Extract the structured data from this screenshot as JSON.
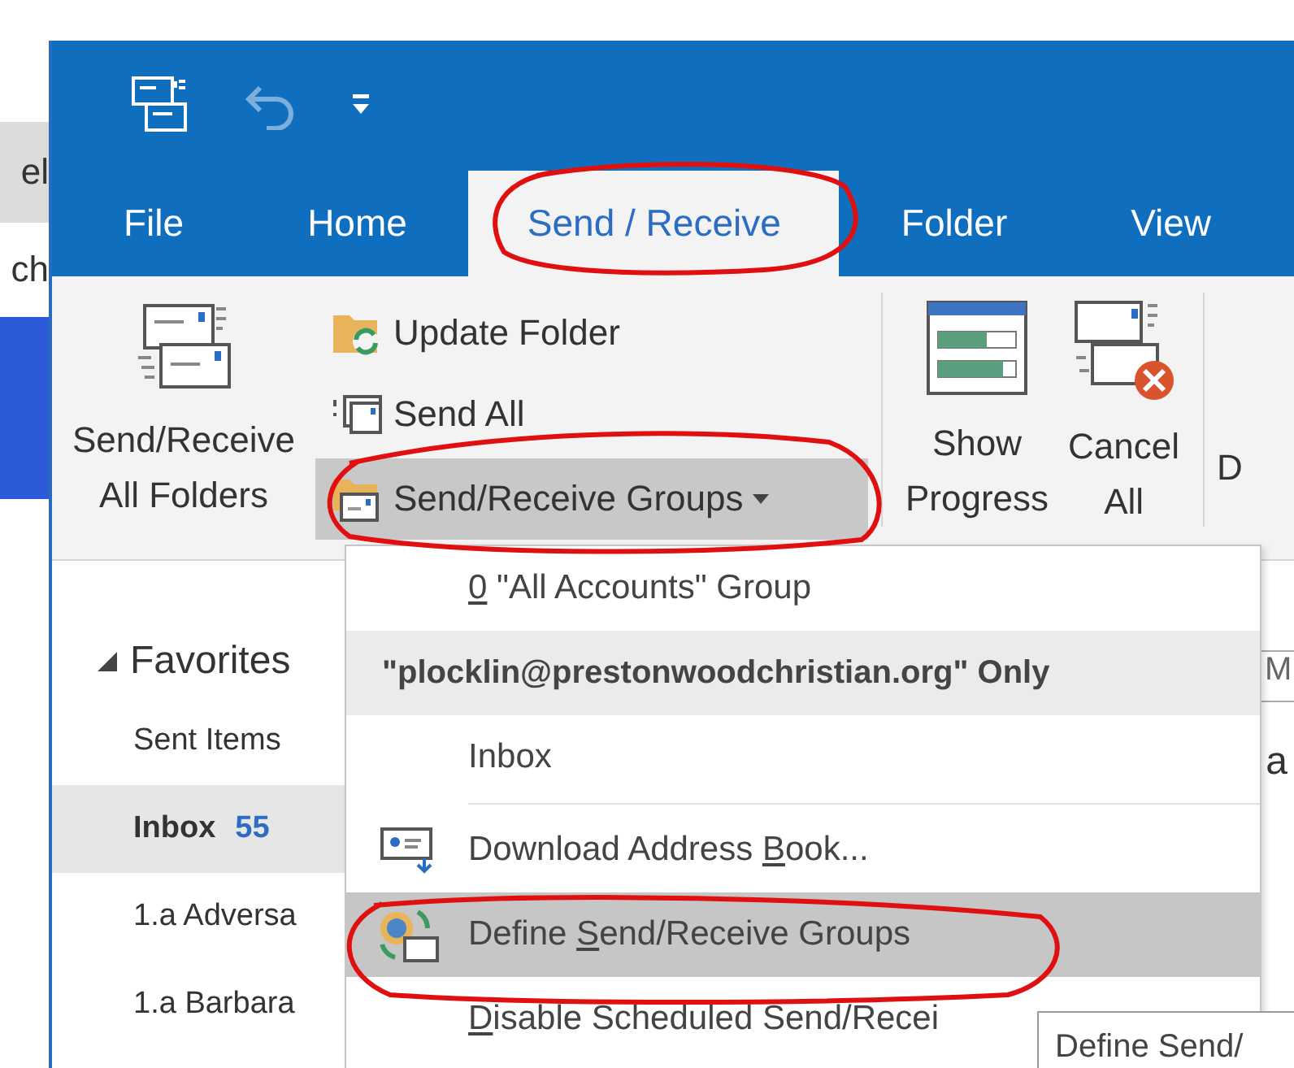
{
  "background_window": {
    "fragments": [
      "el",
      "ch"
    ]
  },
  "quick_access": {
    "undo_disabled": true
  },
  "tabs": [
    {
      "label": "File",
      "selected": false
    },
    {
      "label": "Home",
      "selected": false
    },
    {
      "label": "Send / Receive",
      "selected": true
    },
    {
      "label": "Folder",
      "selected": false
    },
    {
      "label": "View",
      "selected": false
    }
  ],
  "ribbon": {
    "large_button": {
      "lines": [
        "Send/Receive",
        "All Folders"
      ]
    },
    "small_buttons": [
      {
        "label": "Update Folder",
        "highlighted": false,
        "dropdown": false
      },
      {
        "label": "Send All",
        "highlighted": false,
        "dropdown": false
      },
      {
        "label": "Send/Receive Groups",
        "highlighted": true,
        "dropdown": true
      }
    ],
    "download_buttons": [
      {
        "lines": [
          "Show",
          "Progress"
        ]
      },
      {
        "lines": [
          "Cancel",
          "All"
        ]
      }
    ],
    "cut_label": "D"
  },
  "folder_pane": {
    "favorites": {
      "label": "Favorites",
      "expanded": true
    },
    "items": [
      {
        "label": "Sent Items",
        "selected": false
      },
      {
        "label": "Inbox",
        "count": "55",
        "selected": true
      },
      {
        "label": "1.a Adversa",
        "selected": false
      },
      {
        "label": "1.a Barbara",
        "selected": false
      }
    ]
  },
  "right_fragments": [
    "M",
    "a"
  ],
  "menu": [
    {
      "kind": "item",
      "key": "0",
      "after": " \"All Accounts\" Group",
      "selected": false,
      "separator_after": false
    },
    {
      "kind": "header",
      "text": "\"plocklin@prestonwoodchristian.org\" Only"
    },
    {
      "kind": "item",
      "after": "Inbox",
      "selected": false,
      "separator_after": true
    },
    {
      "kind": "item",
      "before": "Download Address ",
      "key": "B",
      "after": "ook...",
      "selected": false,
      "separator_after": false
    },
    {
      "kind": "item",
      "before": "Define ",
      "key": "S",
      "after": "end/Receive Groups",
      "selected": true,
      "separator_after": false
    },
    {
      "kind": "item",
      "key": "D",
      "after": "isable Scheduled Send/Recei",
      "selected": false,
      "separator_after": false
    }
  ],
  "tooltip": "Define Send/"
}
